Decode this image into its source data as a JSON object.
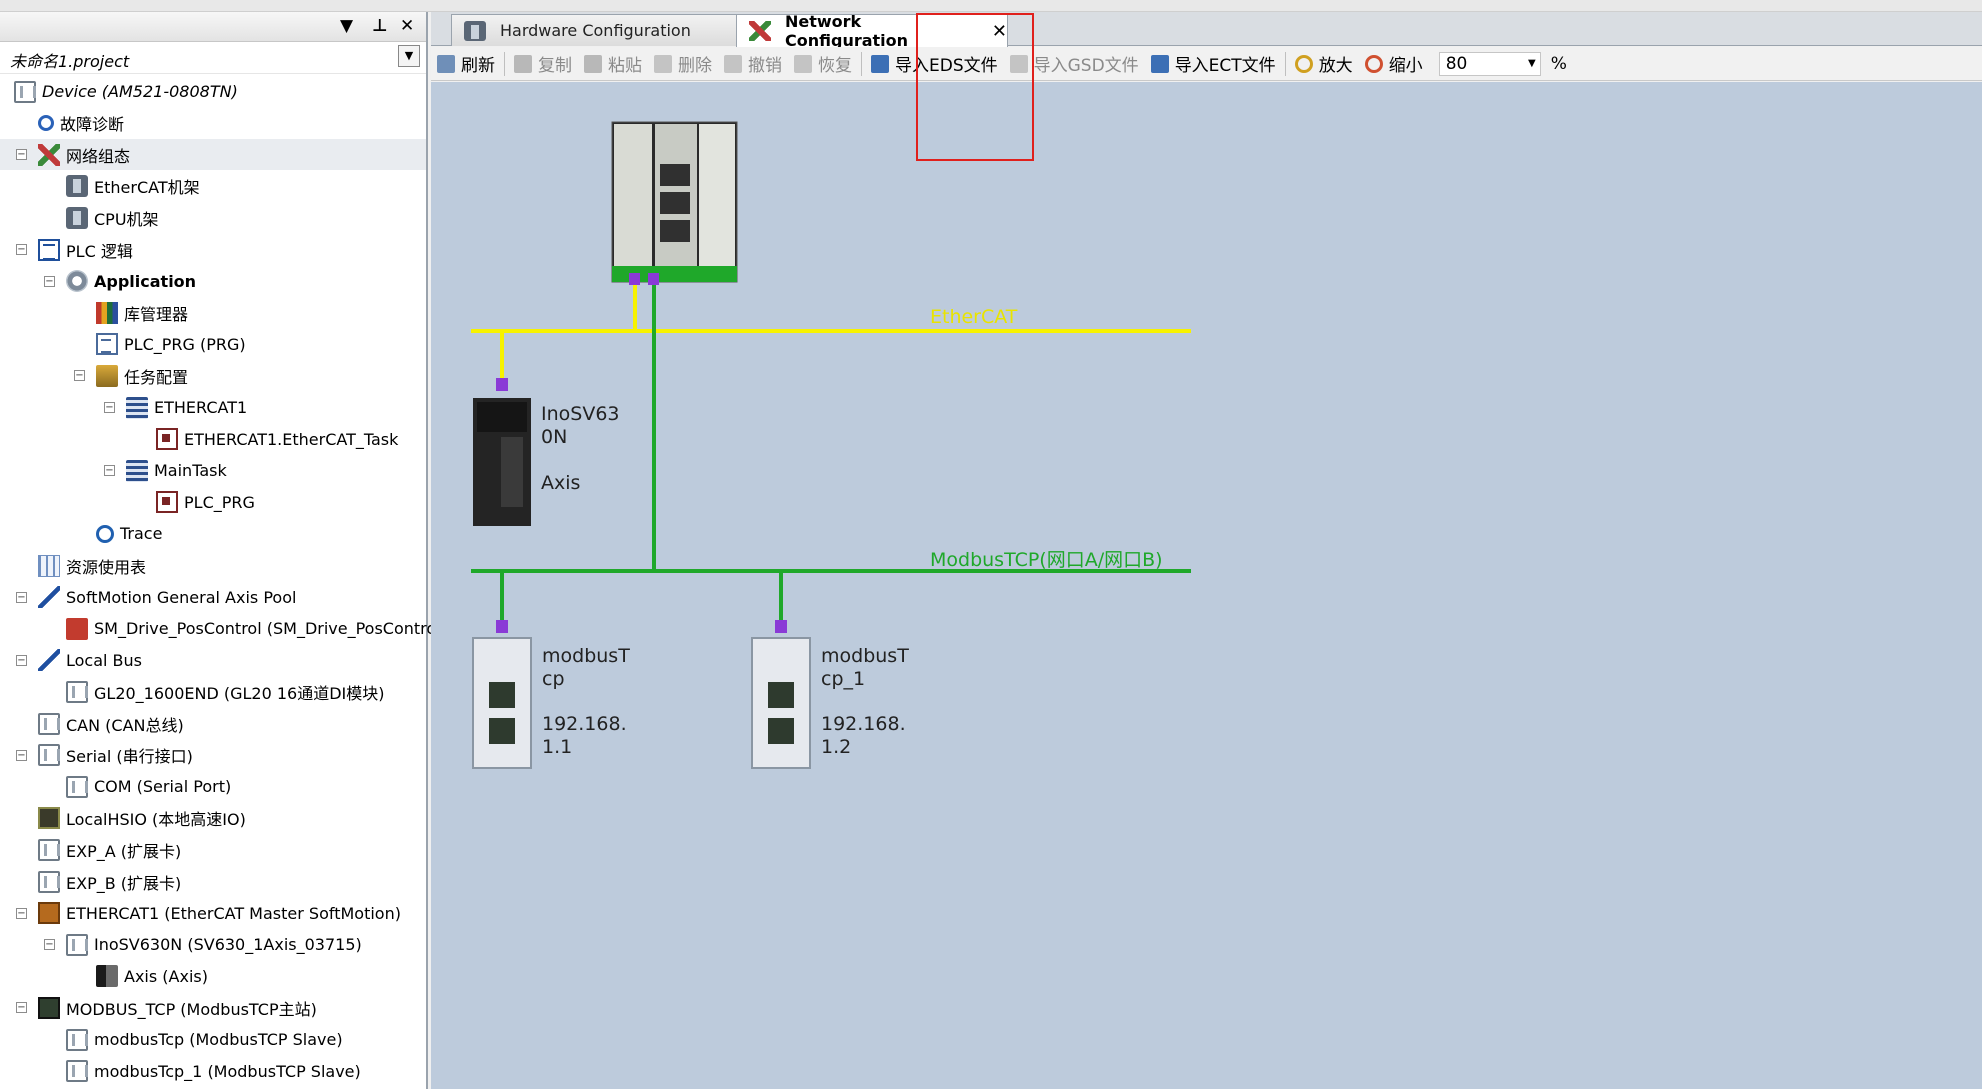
{
  "window": {
    "panel_controls": [
      "▼",
      "⊥",
      "✕"
    ]
  },
  "project": {
    "name": "未命名1.project"
  },
  "tree": [
    {
      "label": "Device (AM521-0808TN)",
      "italic": true,
      "icon": "device-icon"
    },
    {
      "label": "故障诊断",
      "icon": "diagnosis-icon"
    },
    {
      "label": "网络组态",
      "icon": "network-config-icon",
      "selected": true
    },
    {
      "label": "EtherCAT机架",
      "icon": "rack-icon"
    },
    {
      "label": "CPU机架",
      "icon": "rack-icon"
    },
    {
      "label": "PLC 逻辑",
      "icon": "plc-logic-icon"
    },
    {
      "label": "Application",
      "icon": "gear-icon",
      "bold": true
    },
    {
      "label": "库管理器",
      "icon": "library-icon"
    },
    {
      "label": "PLC_PRG (PRG)",
      "icon": "document-icon"
    },
    {
      "label": "任务配置",
      "icon": "task-config-icon"
    },
    {
      "label": "ETHERCAT1",
      "icon": "task-icon"
    },
    {
      "label": "ETHERCAT1.EtherCAT_Task",
      "icon": "program-call-icon"
    },
    {
      "label": "MainTask",
      "icon": "task-icon"
    },
    {
      "label": "PLC_PRG",
      "icon": "program-call-icon"
    },
    {
      "label": "Trace",
      "icon": "trace-icon"
    },
    {
      "label": "资源使用表",
      "icon": "table-icon"
    },
    {
      "label": "SoftMotion General Axis Pool",
      "icon": "softmotion-icon"
    },
    {
      "label": "SM_Drive_PosControl (SM_Drive_PosControl)",
      "icon": "drive-icon"
    },
    {
      "label": "Local Bus",
      "icon": "softmotion-icon"
    },
    {
      "label": "GL20_1600END (GL20 16通道DI模块)",
      "icon": "device-icon"
    },
    {
      "label": "CAN (CAN总线)",
      "icon": "device-icon"
    },
    {
      "label": "Serial (串行接口)",
      "icon": "device-icon"
    },
    {
      "label": "COM (Serial Port)",
      "icon": "device-icon"
    },
    {
      "label": "LocalHSIO (本地高速IO)",
      "icon": "hsio-icon"
    },
    {
      "label": "EXP_A (扩展卡)",
      "icon": "device-icon"
    },
    {
      "label": "EXP_B (扩展卡)",
      "icon": "device-icon"
    },
    {
      "label": "ETHERCAT1 (EtherCAT Master SoftMotion)",
      "icon": "ethercat-master-icon"
    },
    {
      "label": "InoSV630N (SV630_1Axis_03715)",
      "icon": "device-icon"
    },
    {
      "label": "Axis (Axis)",
      "icon": "axis-icon"
    },
    {
      "label": "MODBUS_TCP (ModbusTCP主站)",
      "icon": "modbus-master-icon"
    },
    {
      "label": "modbusTcp (ModbusTCP Slave)",
      "icon": "device-icon"
    },
    {
      "label": "modbusTcp_1 (ModbusTCP Slave)",
      "icon": "device-icon"
    }
  ],
  "tabs": {
    "hardware": "Hardware Configuration",
    "network": "Network Configuration",
    "close": "✕"
  },
  "toolbar": {
    "refresh": "刷新",
    "copy": "复制",
    "paste": "粘贴",
    "delete": "删除",
    "undo": "撤销",
    "redo": "恢复",
    "import_eds": "导入EDS文件",
    "import_gsd": "导入GSD文件",
    "import_ect": "导入ECT文件",
    "zoom_in": "放大",
    "zoom_out": "缩小",
    "zoom_value": "80",
    "zoom_unit": "%"
  },
  "network": {
    "ethercat_bus": "EtherCAT",
    "modbus_bus": "ModbusTCP(网口A/网口B)",
    "servo": {
      "name_l1": "InoSV63",
      "name_l2": "0N",
      "axis": "Axis"
    },
    "slave1": {
      "name_l1": "modbusT",
      "name_l2": "cp",
      "ip_l1": "192.168.",
      "ip_l2": "1.1"
    },
    "slave2": {
      "name_l1": "modbusT",
      "name_l2": "cp_1",
      "ip_l1": "192.168.",
      "ip_l2": "1.2"
    }
  },
  "colors": {
    "ethercat_bus": "#f7f200",
    "modbus_bus": "#1fa82a",
    "canvas_bg": "#bdcbdc",
    "port": "#8a3ad6",
    "highlight": "#e0201c"
  }
}
